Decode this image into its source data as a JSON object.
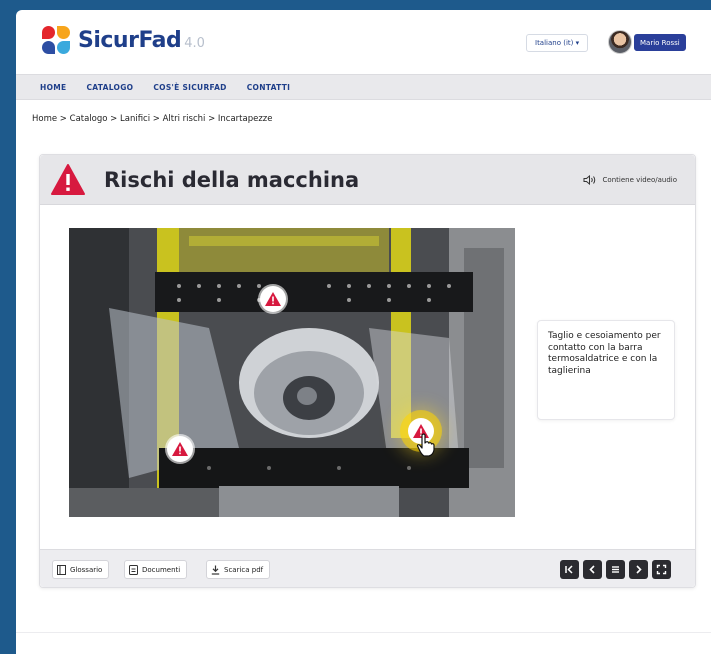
{
  "header": {
    "brand": "SicurFad",
    "brand_version": "4.0",
    "language": "Italiano (it) ▾",
    "user": "Mario Rossi"
  },
  "nav": {
    "items": [
      "HOME",
      "CATALOGO",
      "COS'È SICURFAD",
      "CONTATTI"
    ]
  },
  "breadcrumb": "Home > Catalogo > Lanifici > Altri rischi > Incartapezze",
  "card": {
    "title": "Rischi della macchina",
    "media_note": "Contiene video/audio",
    "callout": "Taglio e cesoiamento per contatto con la barra termosaldatrice e con la taglierina",
    "footer_buttons": [
      "Glossario",
      "Documenti",
      "Scarica pdf"
    ]
  },
  "icons": [
    "speaker-icon",
    "warning-icon",
    "hand-pointer-icon",
    "first-icon",
    "prev-icon",
    "menu-icon",
    "next-icon",
    "fullscreen-icon"
  ],
  "colors": {
    "brand_blue": "#1f3f8a",
    "warning_red": "#d7193f",
    "page_bg": "#1e5a8c",
    "highlight_yellow": "#ffd200"
  }
}
